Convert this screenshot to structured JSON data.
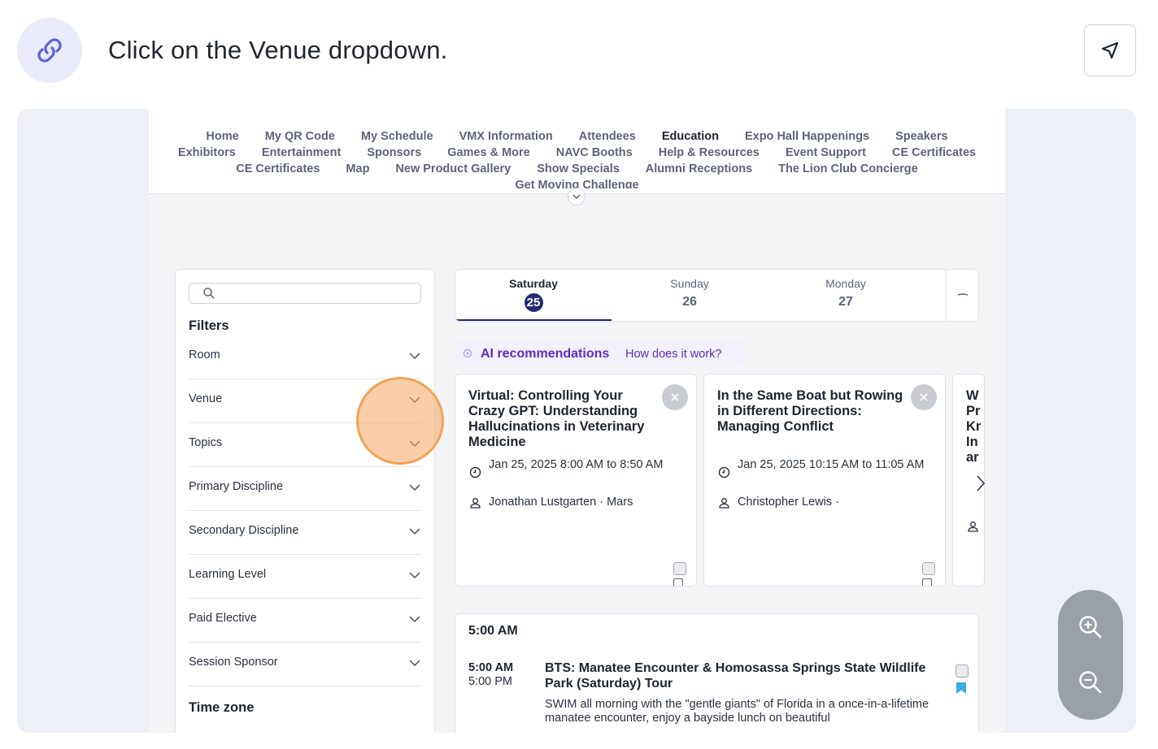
{
  "instruction": "Click on the Venue dropdown.",
  "nav": {
    "row1": [
      "Home",
      "My QR Code",
      "My Schedule",
      "VMX Information",
      "Attendees",
      "Education",
      "Expo Hall Happenings",
      "Speakers"
    ],
    "row2": [
      "Exhibitors",
      "Entertainment",
      "Sponsors",
      "Games & More",
      "NAVC Booths",
      "Help & Resources",
      "Event Support",
      "CE Certificates"
    ],
    "row3": [
      "CE Certificates",
      "Map",
      "New Product Gallery",
      "Show Specials",
      "Alumni Receptions",
      "The Lion Club Concierge"
    ],
    "row4": [
      "Get Moving Challenge"
    ],
    "active": "Education"
  },
  "filters": {
    "title": "Filters",
    "search_placeholder": "",
    "items": [
      "Room",
      "Venue",
      "Topics",
      "Primary Discipline",
      "Secondary Discipline",
      "Learning Level",
      "Paid Elective",
      "Session Sponsor"
    ],
    "timezone_title": "Time zone"
  },
  "days": [
    {
      "name": "Saturday",
      "num": "25",
      "active": true
    },
    {
      "name": "Sunday",
      "num": "26",
      "active": false
    },
    {
      "name": "Monday",
      "num": "27",
      "active": false
    }
  ],
  "ai": {
    "title": "AI recommendations",
    "link": "How does it work?"
  },
  "recommendations": [
    {
      "title": "Virtual: Controlling Your Crazy GPT: Understanding Hallucinations in Veterinary Medicine",
      "time": "Jan 25, 2025 8:00 AM to 8:50 AM",
      "speaker": "Jonathan Lustgarten · Mars"
    },
    {
      "title": "In the Same Boat but Rowing in Different Directions: Managing Conflict",
      "time": "Jan 25, 2025 10:15 AM to 11:05 AM",
      "speaker": "Christopher Lewis ·"
    },
    {
      "title": "W Pr Kr In ar",
      "time": "",
      "speaker": ""
    }
  ],
  "timeline": {
    "hour": "5:00 AM",
    "session": {
      "start": "5:00 AM",
      "end": "5:00 PM",
      "title": "BTS: Manatee Encounter & Homosassa Springs State Wildlife Park (Saturday) Tour",
      "description": "SWIM all morning with the \"gentle giants\" of Florida in a once-in-a-lifetime manatee encounter, enjoy a bayside lunch on beautiful"
    }
  },
  "icons": {
    "badge": "link-icon",
    "nav": "navigation-arrow-icon",
    "zoom_in": "zoom-in-icon",
    "zoom_out": "zoom-out-icon"
  },
  "colors": {
    "accent": "#232b6f",
    "ai_purple": "#5a2ec4",
    "highlight": "#f0a35a",
    "bookmark": "#3ab0e0"
  }
}
